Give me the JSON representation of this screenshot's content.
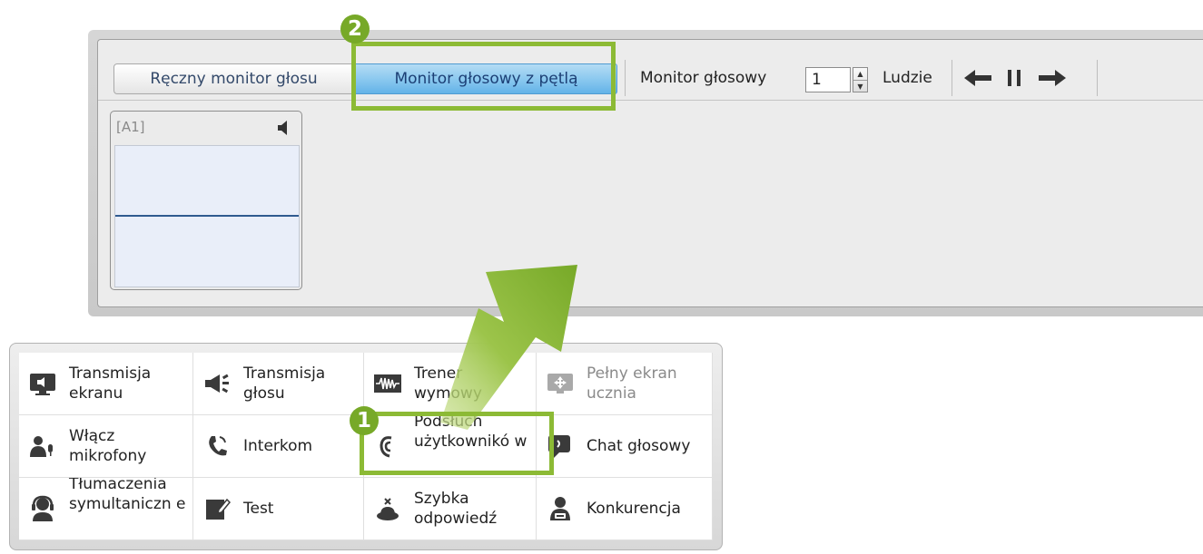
{
  "monitor": {
    "tabs": {
      "manual": "Ręczny monitor głosu",
      "loop": "Monitor głosowy z pętlą"
    },
    "voice_monitor_label": "Monitor głosowy",
    "voice_monitor_value": "1",
    "people_label": "Ludzie",
    "nav_icons": [
      "arrow-left-icon",
      "pause-icon",
      "arrow-right-icon"
    ],
    "channel": {
      "label": "[A1]",
      "icon": "speaker-icon"
    }
  },
  "tools": [
    {
      "label": "Transmisja ekranu",
      "icon": "screen-broadcast-icon"
    },
    {
      "label": "Transmisja głosu",
      "icon": "megaphone-icon"
    },
    {
      "label": "Trener wymowy",
      "icon": "waveform-icon"
    },
    {
      "label": "Pełny ekran ucznia",
      "icon": "fullscreen-icon",
      "disabled": true
    },
    {
      "label": "Włącz mikrofony",
      "icon": "users-mic-icon"
    },
    {
      "label": "Interkom",
      "icon": "phone-icon"
    },
    {
      "label": "Podsłuch użytkownikó w",
      "icon": "ear-icon"
    },
    {
      "label": "Chat głosowy",
      "icon": "voice-chat-icon"
    },
    {
      "label": "Tłumaczenia symultaniczn e",
      "icon": "interpreter-icon"
    },
    {
      "label": "Test",
      "icon": "test-icon"
    },
    {
      "label": "Szybka odpowiedź",
      "icon": "buzzer-icon"
    },
    {
      "label": "Konkurencja",
      "icon": "competition-icon"
    }
  ],
  "callouts": {
    "step1": "1",
    "step2": "2"
  },
  "colors": {
    "callout_green": "#8cba35",
    "active_tab": "#63b3e8"
  }
}
